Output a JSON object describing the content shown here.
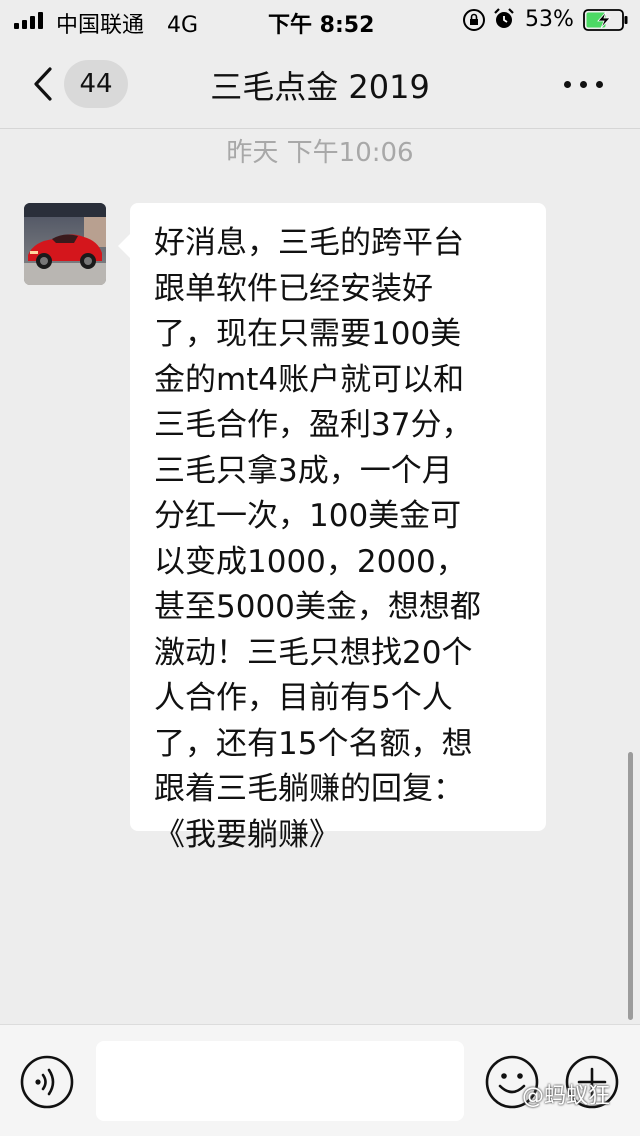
{
  "status_bar": {
    "carrier": "中国联通",
    "network": "4G",
    "time": "下午 8:52",
    "battery": "53%"
  },
  "nav": {
    "unread_count": "44",
    "title": "三毛点金 2019"
  },
  "chat": {
    "timestamp": "昨天 下午10:06",
    "message": {
      "text": "好消息，三毛的跨平台\n跟单软件已经安装好\n了，现在只需要100美\n金的mt4账户就可以和\n三毛合作，盈利37分，\n三毛只拿3成，一个月\n分红一次，100美金可\n以变成1000，2000，\n甚至5000美金，想想都\n激动！三毛只想找20个\n人合作，目前有5个人\n了，还有15个名额，想\n跟着三毛躺赚的回复：\n《我要躺赚》"
    }
  },
  "input_bar": {
    "placeholder": ""
  },
  "watermark": "@蚂蚁狂",
  "colors": {
    "background": "#ededed",
    "bubble": "#ffffff",
    "timestamp": "#a8a8a8",
    "battery_fill": "#4cd964"
  }
}
